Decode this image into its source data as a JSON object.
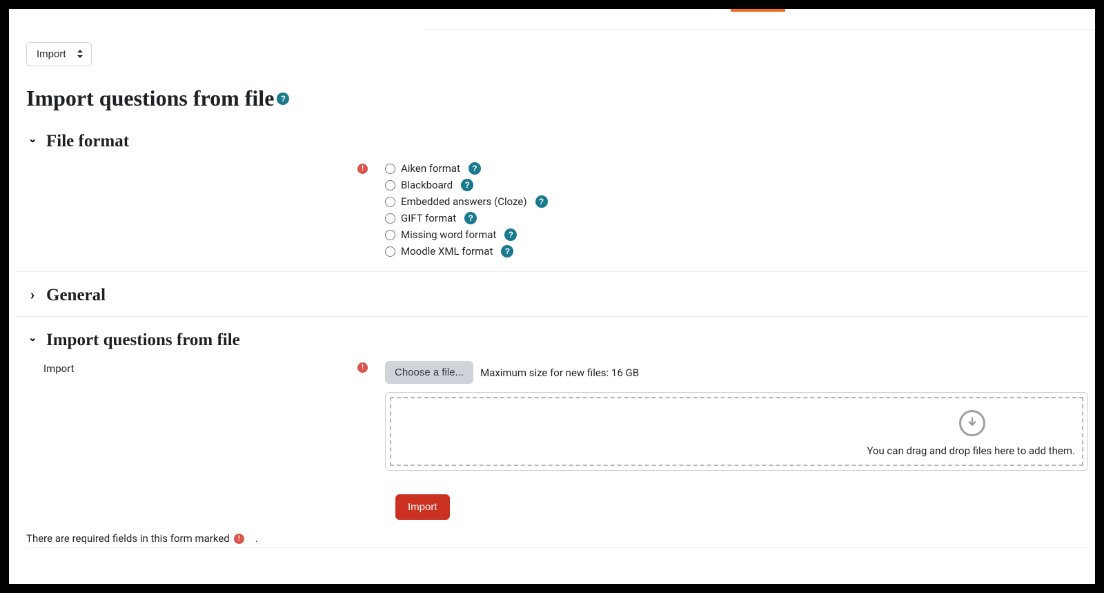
{
  "selector": {
    "value": "Import"
  },
  "pageTitle": "Import questions from file",
  "sections": {
    "fileFormat": {
      "title": "File format",
      "options": [
        "Aiken format",
        "Blackboard",
        "Embedded answers (Cloze)",
        "GIFT format",
        "Missing word format",
        "Moodle XML format"
      ]
    },
    "general": {
      "title": "General"
    },
    "importFile": {
      "title": "Import questions from file",
      "label": "Import",
      "chooseFile": "Choose a file...",
      "maxSize": "Maximum size for new files: 16 GB",
      "dropText": "You can drag and drop files here to add them."
    }
  },
  "submit": {
    "label": "Import"
  },
  "requiredNote": "There are required fields in this form marked",
  "requiredNoteSuffix": "."
}
